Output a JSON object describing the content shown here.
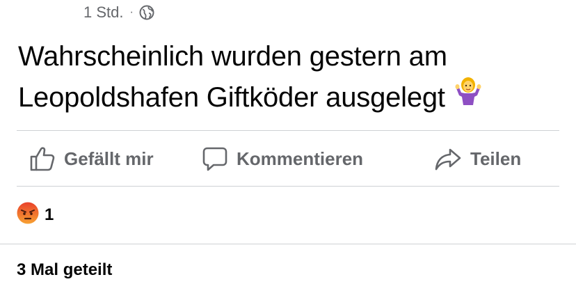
{
  "post": {
    "time": "1 Std.",
    "separator": "·",
    "visibility_icon": "globe-icon",
    "text": "Wahrscheinlich wurden gestern am Leopoldshafen Giftköder ausgelegt",
    "emoji": "person-shrugging-emoji"
  },
  "actions": {
    "like_label": "Gefällt mir",
    "comment_label": "Kommentieren",
    "share_label": "Teilen"
  },
  "reactions": {
    "icon": "angry-reaction-icon",
    "count": "1"
  },
  "shares": {
    "label": "3 Mal geteilt"
  },
  "colors": {
    "text": "#050505",
    "secondary": "#65676b",
    "divider": "#ced0d4",
    "angry": "#f26b1d"
  }
}
